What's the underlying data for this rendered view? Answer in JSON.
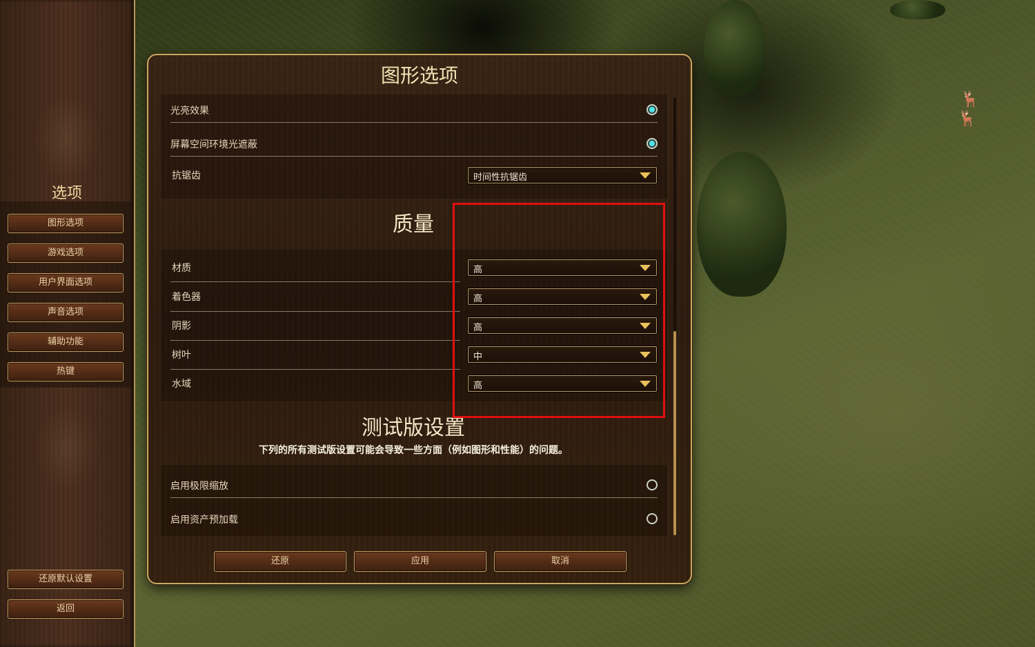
{
  "sidebar": {
    "title": "选项",
    "items": [
      {
        "label": "图形选项"
      },
      {
        "label": "游戏选项"
      },
      {
        "label": "用户界面选项"
      },
      {
        "label": "声音选项"
      },
      {
        "label": "辅助功能"
      },
      {
        "label": "热键"
      }
    ],
    "bottom": [
      {
        "label": "还原默认设置"
      },
      {
        "label": "返回"
      }
    ]
  },
  "dialog": {
    "title": "图形选项",
    "effects_rows": [
      {
        "label": "光亮效果",
        "control": "radio",
        "checked": true
      },
      {
        "label": "屏幕空间环境光遮蔽",
        "control": "radio",
        "checked": true
      },
      {
        "label": "抗锯齿",
        "control": "dropdown",
        "value": "时间性抗锯齿"
      }
    ],
    "quality": {
      "heading": "质量",
      "rows": [
        {
          "label": "材质",
          "value": "高"
        },
        {
          "label": "着色器",
          "value": "高"
        },
        {
          "label": "阴影",
          "value": "高"
        },
        {
          "label": "树叶",
          "value": "中"
        },
        {
          "label": "水域",
          "value": "高"
        }
      ]
    },
    "beta": {
      "heading": "测试版设置",
      "warning": "下列的所有测试版设置可能会导致一些方面（例如图形和性能）的问题。",
      "rows": [
        {
          "label": "启用极限缩放",
          "checked": false
        },
        {
          "label": "启用资产预加载",
          "checked": false
        }
      ]
    },
    "footer": {
      "revert": "还原",
      "apply": "应用",
      "cancel": "取消"
    },
    "scroll_position": 0.53
  },
  "colors": {
    "radio_on": "#4fe3e8",
    "highlight_box": "#e01010",
    "button_border": "#c9a060"
  }
}
